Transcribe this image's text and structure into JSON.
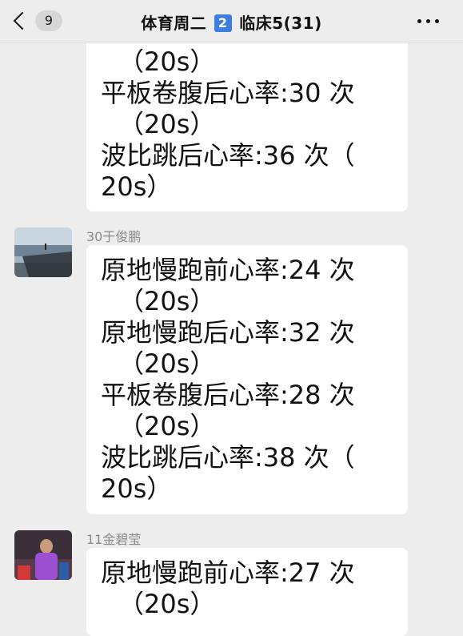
{
  "header": {
    "back_badge": "9",
    "title_prefix": "体育周二",
    "title_box": "2",
    "title_suffix": "临床5(31)"
  },
  "messages": [
    {
      "lines": [
        "（20s）",
        "平板卷腹后心率:30 次",
        "（20s）",
        "波比跳后心率:36 次（",
        "20s）"
      ]
    },
    {
      "sender": "30于俊鹏",
      "lines": [
        "原地慢跑前心率:24 次",
        "（20s）",
        "原地慢跑后心率:32 次",
        "（20s）",
        "平板卷腹后心率:28 次",
        "（20s）",
        "波比跳后心率:38 次（",
        "20s）"
      ]
    },
    {
      "sender": "11金碧莹",
      "lines": [
        "原地慢跑前心率:27 次",
        "（20s）"
      ]
    }
  ]
}
